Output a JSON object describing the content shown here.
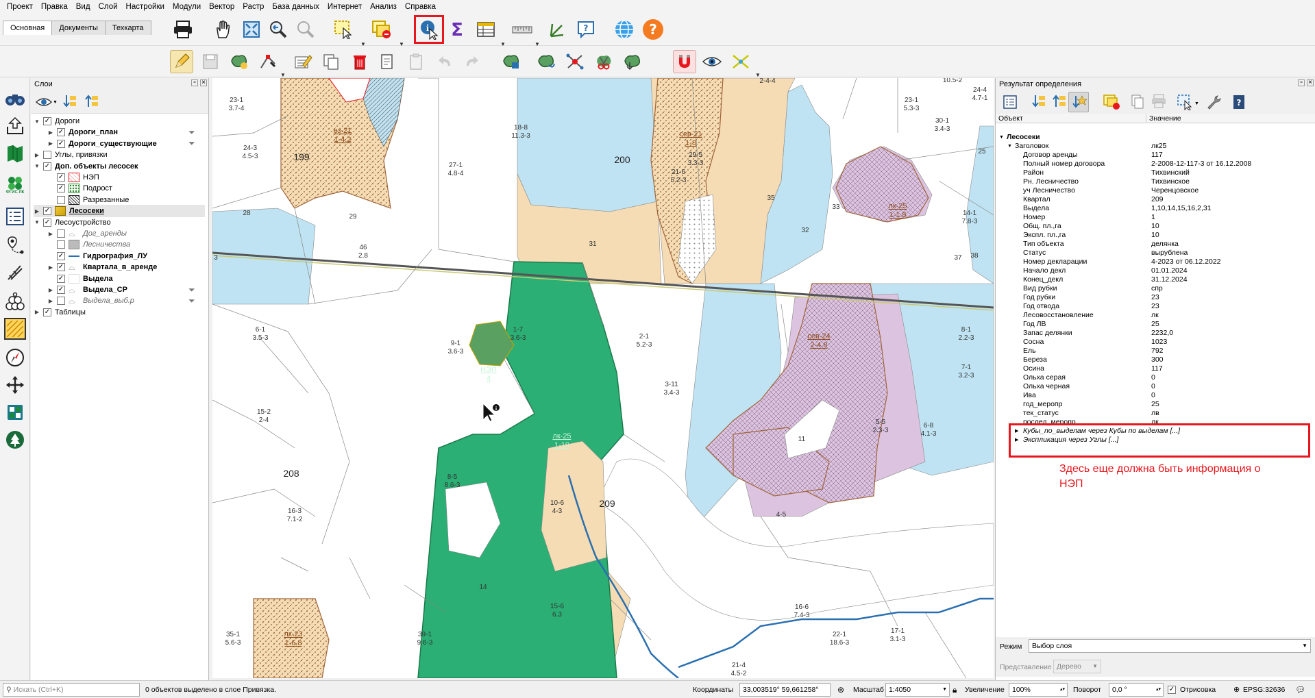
{
  "menu": [
    "Проект",
    "Правка",
    "Вид",
    "Слой",
    "Настройки",
    "Модули",
    "Вектор",
    "Растр",
    "База данных",
    "Интернет",
    "Анализ",
    "Справка"
  ],
  "panel_tabs": [
    "Основная",
    "Документы",
    "Техкарта"
  ],
  "layers_panel": {
    "title": "Слои",
    "items": [
      {
        "label": "Дороги",
        "level": 0,
        "expanded": true,
        "checked": true,
        "style": "normal"
      },
      {
        "label": "Дороги_план",
        "level": 1,
        "expanded": false,
        "checked": true,
        "style": "bold"
      },
      {
        "label": "Дороги_существующие",
        "level": 1,
        "expanded": false,
        "checked": true,
        "style": "bold"
      },
      {
        "label": "Углы, привязки",
        "level": 0,
        "expanded": false,
        "checked": false,
        "style": "normal"
      },
      {
        "label": "Доп. объекты лесосек",
        "level": 0,
        "expanded": true,
        "checked": true,
        "style": "bold"
      },
      {
        "label": "НЭП",
        "level": 1,
        "checked": true,
        "style": "normal"
      },
      {
        "label": "Подрост",
        "level": 1,
        "checked": true,
        "style": "normal"
      },
      {
        "label": "Разрезанные",
        "level": 1,
        "checked": false,
        "style": "normal"
      },
      {
        "label": "Лесосеки",
        "level": 0,
        "expanded": false,
        "checked": true,
        "style": "bold-underline"
      },
      {
        "label": "Лесоустройство",
        "level": 0,
        "expanded": true,
        "checked": true,
        "style": "normal"
      },
      {
        "label": "Дог_аренды",
        "level": 1,
        "expanded": false,
        "checked": false,
        "style": "italic"
      },
      {
        "label": "Лесничества",
        "level": 1,
        "checked": false,
        "style": "italic"
      },
      {
        "label": "Гидрография_ЛУ",
        "level": 1,
        "checked": true,
        "style": "bold"
      },
      {
        "label": "Квартала_в_аренде",
        "level": 1,
        "expanded": false,
        "checked": true,
        "style": "bold"
      },
      {
        "label": "Выдела",
        "level": 1,
        "checked": true,
        "style": "bold"
      },
      {
        "label": "Выдела_СР",
        "level": 1,
        "expanded": false,
        "checked": true,
        "style": "bold"
      },
      {
        "label": "Выдела_выб.р",
        "level": 1,
        "expanded": false,
        "checked": false,
        "style": "italic"
      },
      {
        "label": "Таблицы",
        "level": 0,
        "expanded": false,
        "checked": true,
        "style": "normal"
      }
    ]
  },
  "ident_panel": {
    "title": "Результат определения",
    "col_object": "Объект",
    "col_value": "Значение",
    "layer": "Лесосеки",
    "header_key": "Заголовок",
    "header_value": "лк25",
    "attributes": [
      [
        "Договор аренды",
        "117"
      ],
      [
        "Полный номер договора",
        "2-2008-12-117-3 от 16.12.2008"
      ],
      [
        "Район",
        "Тихвинский"
      ],
      [
        "Рн. Лесничество",
        "Тихвинское"
      ],
      [
        "уч Лесничество",
        "Черенцовское"
      ],
      [
        "Квартал",
        "209"
      ],
      [
        "Выдела",
        "1,10,14,15,16,2,31"
      ],
      [
        "Номер",
        "1"
      ],
      [
        "Общ. пл.,га",
        "10"
      ],
      [
        "Экспл. пл.,га",
        "10"
      ],
      [
        "Тип объекта",
        "делянка"
      ],
      [
        "Статус",
        "вырублена"
      ],
      [
        "Номер декларации",
        "4-2023 от 06.12.2022"
      ],
      [
        "Начало декл",
        "01.01.2024"
      ],
      [
        "Конец_декл",
        "31.12.2024"
      ],
      [
        "Вид рубки",
        "спр"
      ],
      [
        "Год рубки",
        "23"
      ],
      [
        "Год отвода",
        "23"
      ],
      [
        "Лесовосстановление",
        "лк"
      ],
      [
        "Год ЛВ",
        "25"
      ],
      [
        "Запас делянки",
        "2232,0"
      ],
      [
        "Сосна",
        "1023"
      ],
      [
        "Ель",
        "792"
      ],
      [
        "Береза",
        "300"
      ],
      [
        "Осина",
        "117"
      ],
      [
        "Ольха серая",
        "0"
      ],
      [
        "Ольха черная",
        "0"
      ],
      [
        "Ива",
        "0"
      ],
      [
        "год_меропр",
        "25"
      ],
      [
        "тек_статус",
        "лв"
      ],
      [
        "послед_меропр",
        "лк"
      ]
    ],
    "relations": [
      "Кубы_по_выделам через Кубы по выделам [...]",
      "Экспликация через Углы [...]"
    ],
    "annotation": "Здесь еще должна быть информация о НЭП",
    "mode_label": "Режим",
    "mode_value": "Выбор слоя",
    "repr_label": "Представление",
    "repr_value": "Дерево"
  },
  "map": {
    "quarters": [
      "199",
      "200",
      "208",
      "209"
    ],
    "labels": [
      [
        "23-1",
        "3.7-4"
      ],
      [
        "24-3",
        "4.5-3"
      ],
      [
        "28",
        ""
      ],
      [
        "29",
        ""
      ],
      [
        "27-1",
        "4.8-4"
      ],
      [
        "18-8",
        "11.3-3"
      ],
      [
        "31",
        ""
      ],
      [
        "29-5",
        "3.3-3"
      ],
      [
        "21-6",
        "5.2-3"
      ],
      [
        "35",
        ""
      ],
      [
        "32",
        ""
      ],
      [
        "23-1",
        "5.3-3"
      ],
      [
        "30-1",
        "3.4-3"
      ],
      [
        "25",
        ""
      ],
      [
        "10.5-2",
        ""
      ],
      [
        "24-4",
        "4.7-1"
      ],
      [
        "14-1",
        "7.8-3"
      ],
      [
        "37",
        ""
      ],
      [
        "38",
        ""
      ],
      [
        "8-1",
        "2.2-3"
      ],
      [
        "7-1",
        "3.2-3"
      ],
      [
        "6-8",
        "4.1-3"
      ],
      [
        "5-5",
        "2.3-3"
      ],
      [
        "11",
        ""
      ],
      [
        "3-11",
        "3.4-3"
      ],
      [
        "2-1",
        "5.2-3"
      ],
      [
        "9-1",
        "3.6-3"
      ],
      [
        "6-1",
        "3.5-3"
      ],
      [
        "15-2",
        "2-4"
      ],
      [
        "16-3",
        "7.1-2"
      ],
      [
        "8-5",
        "8.6-3"
      ],
      [
        "14",
        ""
      ],
      [
        "35-1",
        "5.6-3"
      ],
      [
        "39-1",
        "9.6-3"
      ],
      [
        "16-6",
        "7.4-3"
      ],
      [
        "22-1",
        "18.6-3"
      ],
      [
        "17-1",
        "3.1-3"
      ],
      [
        "21-4",
        "4.5-2"
      ],
      [
        "4-5",
        ""
      ],
      [
        "46",
        "2.8"
      ],
      [
        "3",
        ""
      ],
      [
        "2-4-4",
        ""
      ],
      [
        "33",
        ""
      ],
      [
        "1-7",
        "3.6-3"
      ],
      [
        "10-6",
        "4-3"
      ],
      [
        "15-6",
        "6.3"
      ]
    ],
    "plots": [
      [
        "сев-21",
        "1-8"
      ],
      [
        "сев-24",
        "2-4.8"
      ],
      [
        "лк-25",
        "1-1.8"
      ],
      [
        "лк-23",
        "1-6.8"
      ],
      [
        "ез-21",
        "1-4.2"
      ],
      [
        "лк-25",
        "1-10"
      ],
      [
        "НЭП",
        "4"
      ]
    ]
  },
  "status": {
    "search_placeholder": "Искать (Ctrl+K)",
    "message": "0 объектов выделено в слое Привязка.",
    "coord_label": "Координаты",
    "coord_value": "33,003519° 59,661258°",
    "scale_label": "Масштаб",
    "scale_value": "1:4050",
    "zoom_label": "Увеличение",
    "zoom_value": "100%",
    "rotation_label": "Поворот",
    "rotation_value": "0,0 °",
    "render_label": "Отрисовка",
    "crs": "EPSG:32636"
  }
}
